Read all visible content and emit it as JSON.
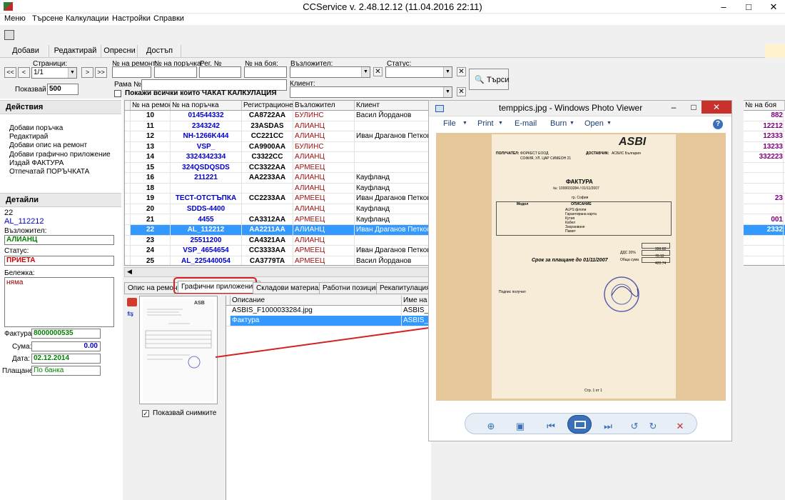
{
  "window": {
    "title": "CCService v. 2.48.12.12 (11.04.2016 22:11)",
    "min": "–",
    "max": "□",
    "close": "✕"
  },
  "menu": [
    "Меню",
    "Търсене",
    "Калкулации",
    "Настройки",
    "Справки"
  ],
  "toolbar": {
    "tabs": [
      "Добави",
      "Редактирай",
      "Опресни",
      "Достъп"
    ]
  },
  "filters": {
    "pages_label": "Страници:",
    "page_value": "1/1",
    "shown_label": "Показвай",
    "shown_value": "500",
    "repair_label": "№ на ремонт:",
    "order_label": "№ на поръчка:",
    "reg_label": "Рег. №",
    "paint_label": "№ на боя:",
    "contractor_label": "Възложител:",
    "status_label": "Статус:",
    "frame_label": "Рама №",
    "client_label": "Клиент:",
    "show_all_label": "Покажи всички които ЧАКАТ КАЛКУЛАЦИЯ",
    "search_button": "Търси",
    "nav": [
      "<<",
      "<",
      ">",
      ">>"
    ]
  },
  "actions": {
    "title": "Действия",
    "items": [
      "Добави поръчка",
      "Редактирай",
      "Добави опис на ремонт",
      "Добави графично приложение",
      "Издай ФАКТУРА",
      "Отпечатай ПОРЪЧКАТА"
    ]
  },
  "details": {
    "title": "Детайли",
    "id": "22",
    "order": "AL_112212",
    "contractor_label": "Възложител:",
    "contractor": "АЛИАНЦ",
    "status_label": "Статус:",
    "status": "ПРИЕТА",
    "note_label": "Бележка:",
    "note": "няма",
    "invoice_label": "Фактура:",
    "invoice": "8000000535",
    "sum_label": "Сума:",
    "sum": "0.00",
    "date_label": "Дата:",
    "date": "02.12.2014",
    "payment_label": "Плащане:",
    "payment": "По банка"
  },
  "grid": {
    "headers": [
      "№ на ремонт",
      "№ на поръчка",
      "Регистрационен №",
      "Възложител",
      "Клиент"
    ],
    "right_header": "№ на боя",
    "rows": [
      {
        "n": "10",
        "order": "014544332",
        "reg": "CA8722AA",
        "contractor": "БУЛИНС",
        "client": "Васил Йорданов",
        "paint": "882"
      },
      {
        "n": "11",
        "order": "2343242",
        "reg": "23ASDAS",
        "contractor": "АЛИАНЦ",
        "client": "",
        "paint": "12212"
      },
      {
        "n": "12",
        "order": "NH-1266K444",
        "reg": "CC221CC",
        "contractor": "АЛИАНЦ",
        "client": "Иван Драганов Петков",
        "paint": "12333"
      },
      {
        "n": "13",
        "order": "VSP_",
        "reg": "CA9900AA",
        "contractor": "БУЛИНС",
        "client": "",
        "paint": "13233"
      },
      {
        "n": "14",
        "order": "3324342334",
        "reg": "C3322CC",
        "contractor": "АЛИАНЦ",
        "client": "",
        "paint": "332223"
      },
      {
        "n": "15",
        "order": "324QSDQSDS",
        "reg": "CC3322AA",
        "contractor": "АРМЕЕЦ",
        "client": "",
        "paint": ""
      },
      {
        "n": "16",
        "order": "211221",
        "reg": "AA2233AA",
        "contractor": "АЛИАНЦ",
        "client": "Кауфланд",
        "paint": ""
      },
      {
        "n": "18",
        "order": "",
        "reg": "",
        "contractor": "АЛИАНЦ",
        "client": "Кауфланд",
        "paint": ""
      },
      {
        "n": "19",
        "order": "ТЕСТ-ОТСТЪПКА",
        "reg": "CC2233AA",
        "contractor": "АРМЕЕЦ",
        "client": "Иван Драганов Петков",
        "paint": "23"
      },
      {
        "n": "20",
        "order": "SDDS-4400",
        "reg": "",
        "contractor": "АЛИАНЦ",
        "client": "Кауфланд",
        "paint": ""
      },
      {
        "n": "21",
        "order": "4455",
        "reg": "CA3312AA",
        "contractor": "АРМЕЕЦ",
        "client": "Кауфланд",
        "paint": "001"
      },
      {
        "n": "22",
        "order": "AL_112212",
        "reg": "AA2211AA",
        "contractor": "АЛИАНЦ",
        "client": "Иван Драганов Петков",
        "paint": "2332",
        "selected": true
      },
      {
        "n": "23",
        "order": "25511200",
        "reg": "CA4321AA",
        "contractor": "АЛИАНЦ",
        "client": "",
        "paint": ""
      },
      {
        "n": "24",
        "order": "VSP_4654654",
        "reg": "CC3333AA",
        "contractor": "АРМЕЕЦ",
        "client": "Иван Драганов Петков",
        "paint": ""
      },
      {
        "n": "25",
        "order": "AL_225440054",
        "reg": "CA3779TA",
        "contractor": "АРМЕЕЦ",
        "client": "Васил Йорданов",
        "paint": ""
      }
    ]
  },
  "tabs": [
    "Опис на ремонт",
    "Графични приложения",
    "Складови материали",
    "Работни позиции",
    "Рекапитулация"
  ],
  "attachments": {
    "headers": [
      "Описание",
      "Име на ф"
    ],
    "rows": [
      {
        "desc": "ASBIS_F1000033284.jpg",
        "file": "ASBIS_F"
      },
      {
        "desc": "Фактура",
        "file": "ASBIS_F"
      }
    ],
    "show_thumbs": "Показвай снимките"
  },
  "photo_viewer": {
    "title": "temppics.jpg - Windows Photo Viewer",
    "menu": [
      "File",
      "Print",
      "E-mail",
      "Burn",
      "Open"
    ],
    "help": "?"
  },
  "invoice_doc": {
    "logo": "ASBI",
    "recipient_label": "ПОЛУЧАТЕЛ:",
    "recipient": "ФОРКЕСТ ЕООД",
    "supplier_label": "ДОСТАВЧИК:",
    "supplier": "АСБИС България",
    "address": "СОФИЯ, УЛ. ЦАР СИМЕОН 21",
    "title": "ФАКТУРА",
    "number": "№: 1000033284 / 01/11/2007",
    "city": "гр. София",
    "col_desc": "ОПИСАНИЕ",
    "col_model": "Модел",
    "lines": [
      "ALPS флопи",
      "Гарантирана карта",
      "Кутия",
      "Кабел",
      "Захранване",
      "Памет"
    ],
    "due": "Срок за плащане до 01/11/2007",
    "vat_label": "ДДС 20%",
    "total_label": "Обща сума",
    "total": "420.74",
    "base": "350.62",
    "vat": "70.12",
    "page": "Стр. 1 от 1",
    "received": "Подпис получил"
  }
}
